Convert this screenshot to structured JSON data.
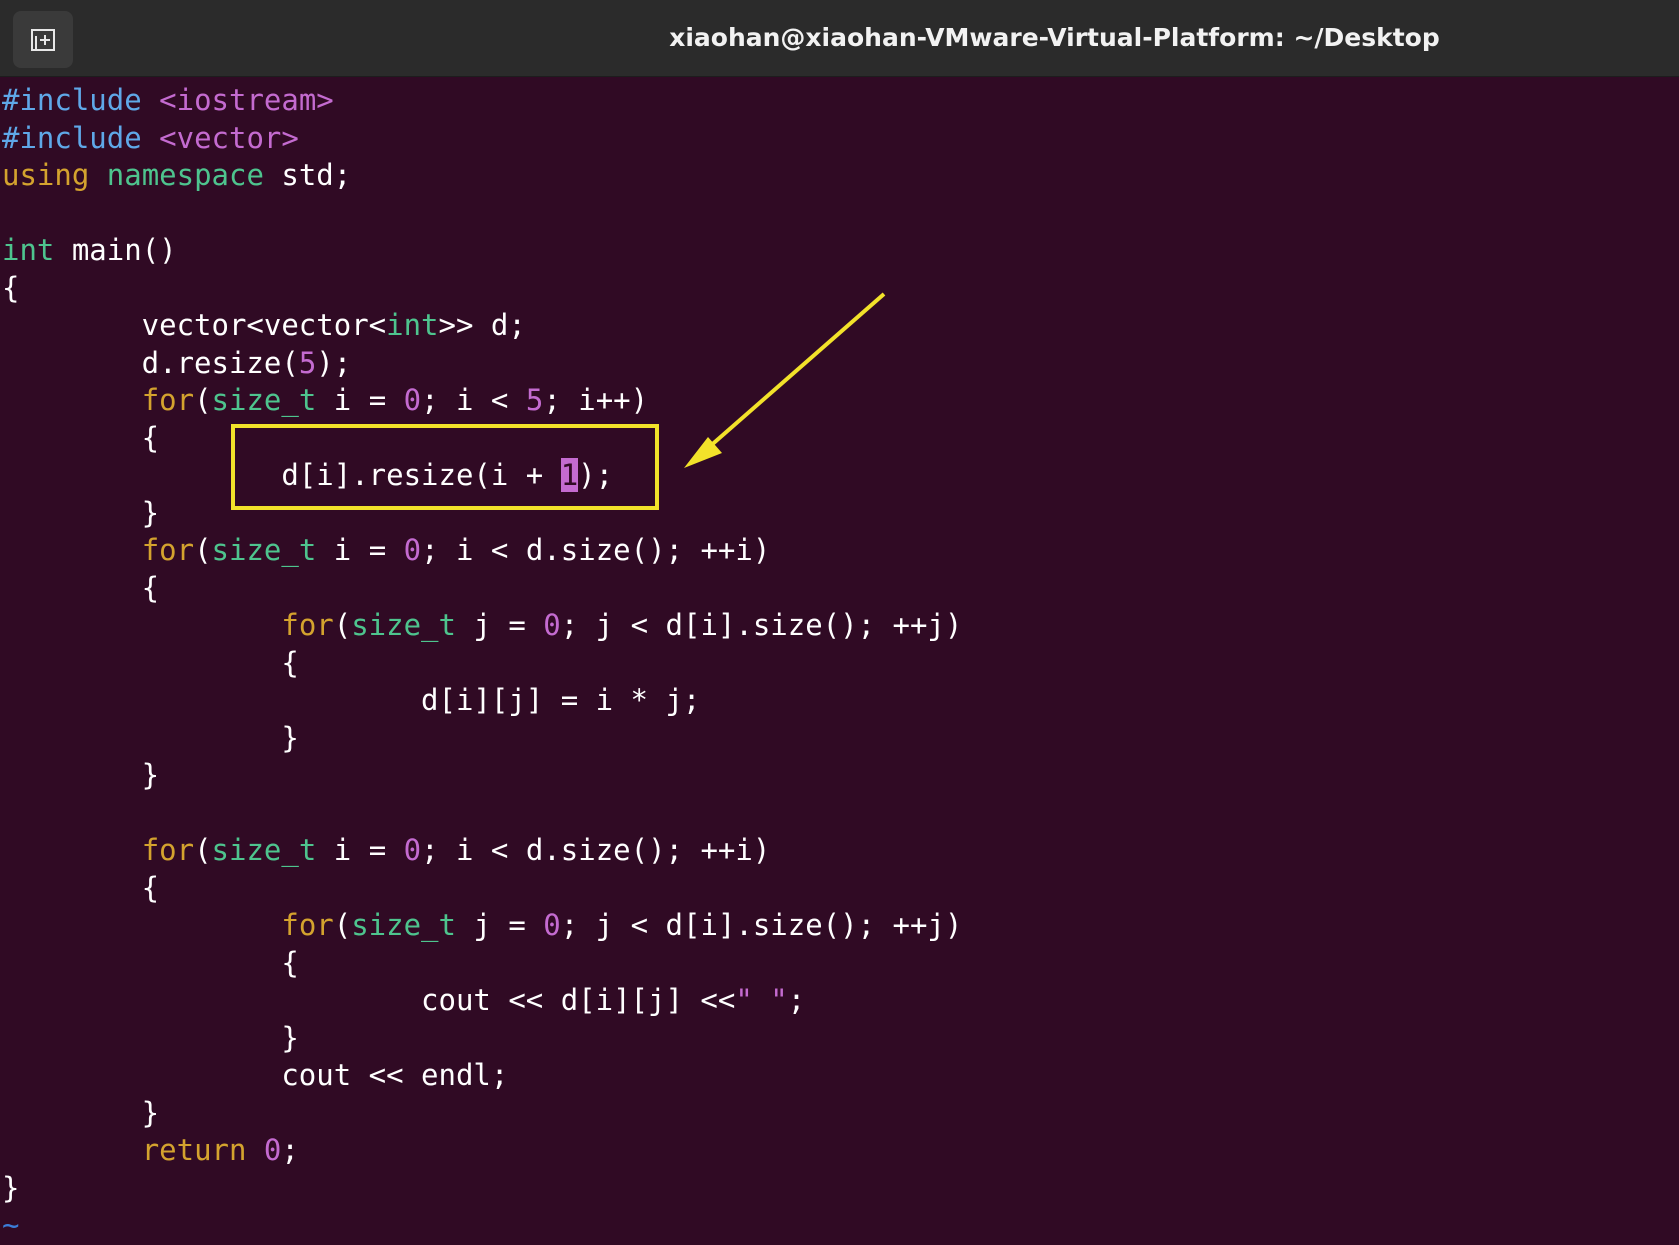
{
  "window": {
    "title": "xiaohan@xiaohan-VMware-Virtual-Platform: ~/Desktop",
    "new_tab_icon": "new-tab-icon"
  },
  "editor": {
    "lines": [
      [
        {
          "t": "#include",
          "c": "pp"
        },
        {
          "t": " "
        },
        {
          "t": "<iostream>",
          "c": "inc"
        }
      ],
      [
        {
          "t": "#include",
          "c": "pp"
        },
        {
          "t": " "
        },
        {
          "t": "<vector>",
          "c": "inc"
        }
      ],
      [
        {
          "t": "using",
          "c": "kw"
        },
        {
          "t": " "
        },
        {
          "t": "namespace",
          "c": "ty"
        },
        {
          "t": " std;"
        }
      ],
      [],
      [
        {
          "t": "int",
          "c": "ty"
        },
        {
          "t": " main()"
        }
      ],
      [
        {
          "t": "{"
        }
      ],
      [
        {
          "t": "        vector<vector<"
        },
        {
          "t": "int",
          "c": "ty"
        },
        {
          "t": ">> d;"
        }
      ],
      [
        {
          "t": "        d.resize("
        },
        {
          "t": "5",
          "c": "num"
        },
        {
          "t": ");"
        }
      ],
      [
        {
          "t": "        "
        },
        {
          "t": "for",
          "c": "kw"
        },
        {
          "t": "("
        },
        {
          "t": "size_t",
          "c": "ty"
        },
        {
          "t": " i = "
        },
        {
          "t": "0",
          "c": "num"
        },
        {
          "t": "; i < "
        },
        {
          "t": "5",
          "c": "num"
        },
        {
          "t": "; i++)"
        }
      ],
      [
        {
          "t": "        {"
        }
      ],
      [
        {
          "t": "                d[i].resize(i + "
        },
        {
          "t": "1",
          "c": "cursor"
        },
        {
          "t": ");"
        }
      ],
      [
        {
          "t": "        }"
        }
      ],
      [
        {
          "t": "        "
        },
        {
          "t": "for",
          "c": "kw"
        },
        {
          "t": "("
        },
        {
          "t": "size_t",
          "c": "ty"
        },
        {
          "t": " i = "
        },
        {
          "t": "0",
          "c": "num"
        },
        {
          "t": "; i < d.size(); ++i)"
        }
      ],
      [
        {
          "t": "        {"
        }
      ],
      [
        {
          "t": "                "
        },
        {
          "t": "for",
          "c": "kw"
        },
        {
          "t": "("
        },
        {
          "t": "size_t",
          "c": "ty"
        },
        {
          "t": " j = "
        },
        {
          "t": "0",
          "c": "num"
        },
        {
          "t": "; j < d[i].size(); ++j)"
        }
      ],
      [
        {
          "t": "                {"
        }
      ],
      [
        {
          "t": "                        d[i][j] = i * j;"
        }
      ],
      [
        {
          "t": "                }"
        }
      ],
      [
        {
          "t": "        }"
        }
      ],
      [],
      [
        {
          "t": "        "
        },
        {
          "t": "for",
          "c": "kw"
        },
        {
          "t": "("
        },
        {
          "t": "size_t",
          "c": "ty"
        },
        {
          "t": " i = "
        },
        {
          "t": "0",
          "c": "num"
        },
        {
          "t": "; i < d.size(); ++i)"
        }
      ],
      [
        {
          "t": "        {"
        }
      ],
      [
        {
          "t": "                "
        },
        {
          "t": "for",
          "c": "kw"
        },
        {
          "t": "("
        },
        {
          "t": "size_t",
          "c": "ty"
        },
        {
          "t": " j = "
        },
        {
          "t": "0",
          "c": "num"
        },
        {
          "t": "; j < d[i].size(); ++j)"
        }
      ],
      [
        {
          "t": "                {"
        }
      ],
      [
        {
          "t": "                        cout << d[i][j] <<"
        },
        {
          "t": "\" \"",
          "c": "str"
        },
        {
          "t": ";"
        }
      ],
      [
        {
          "t": "                }"
        }
      ],
      [
        {
          "t": "                cout << endl;"
        }
      ],
      [
        {
          "t": "        }"
        }
      ],
      [
        {
          "t": "        "
        },
        {
          "t": "return",
          "c": "kw"
        },
        {
          "t": " "
        },
        {
          "t": "0",
          "c": "num"
        },
        {
          "t": ";"
        }
      ],
      [
        {
          "t": "}"
        }
      ],
      [
        {
          "t": "~",
          "c": "tilde"
        }
      ]
    ]
  },
  "colors": {
    "background": "#300a24",
    "titlebar": "#2b2b2b",
    "preprocessor": "#5fa8e8",
    "keyword": "#d4a32e",
    "type": "#4ec48e",
    "number": "#c46bd0",
    "annotation": "#f2e22a"
  }
}
